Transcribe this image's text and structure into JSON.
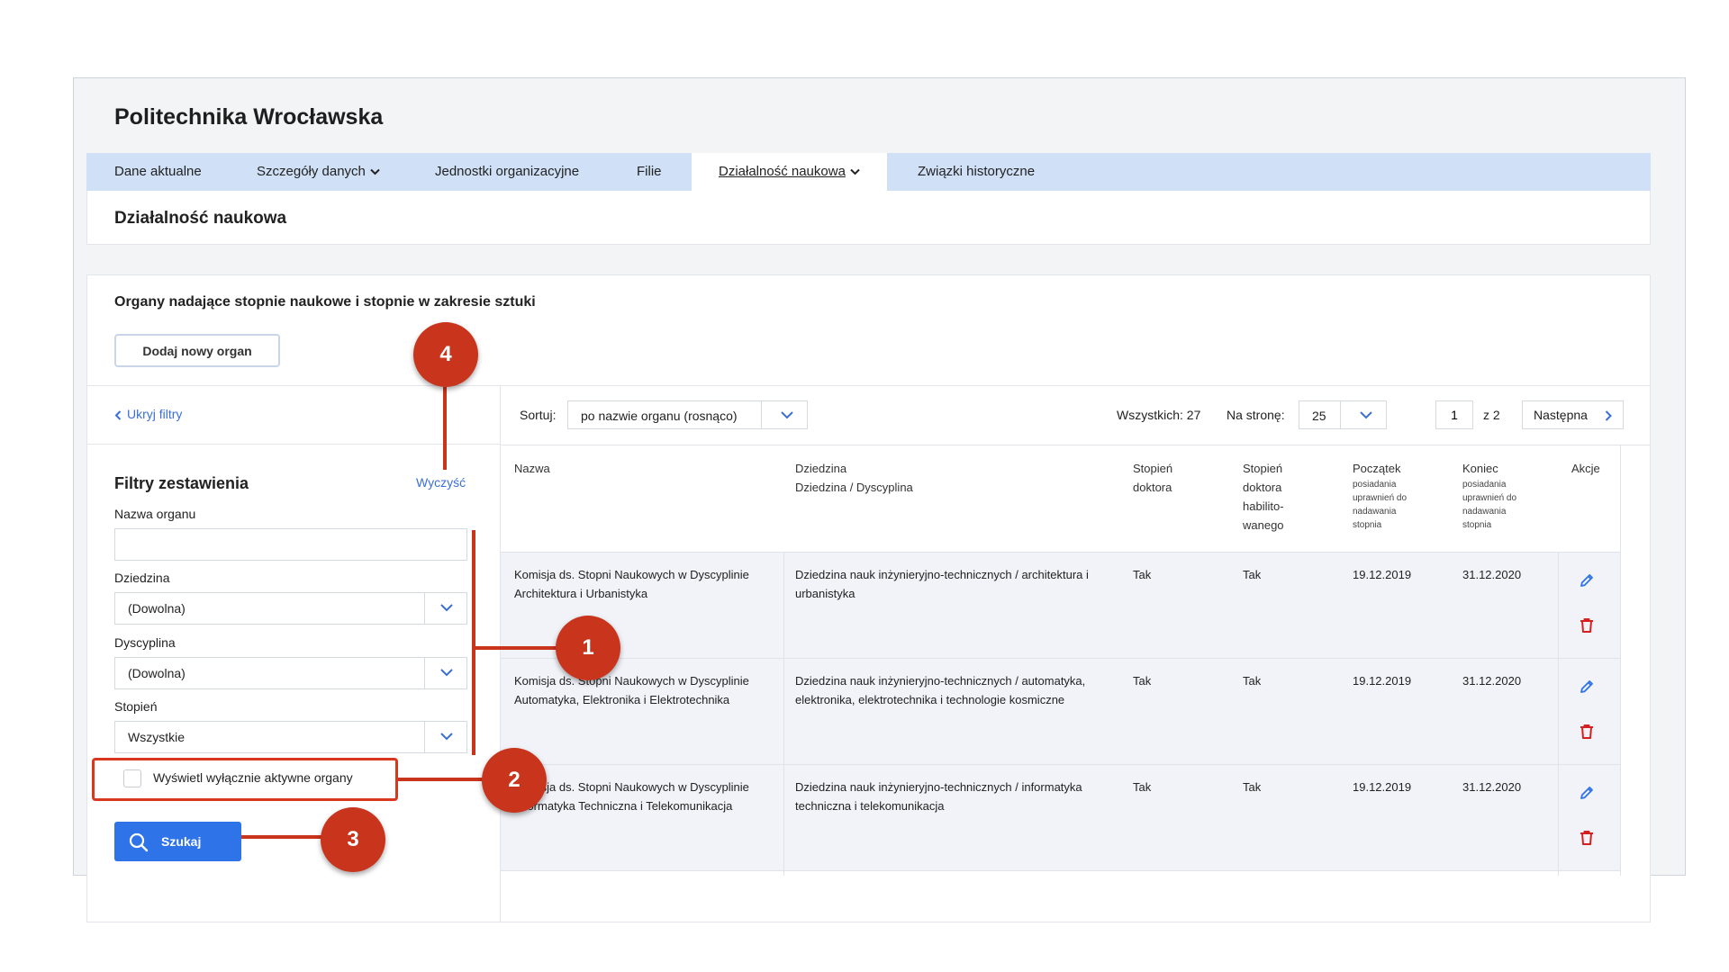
{
  "app": {
    "title": "Politechnika Wrocławska"
  },
  "nav": {
    "items": [
      {
        "label": "Dane aktualne"
      },
      {
        "label": "Szczegóły danych"
      },
      {
        "label": "Jednostki organizacyjne"
      },
      {
        "label": "Filie"
      },
      {
        "label": "Działalność naukowa"
      },
      {
        "label": "Związki historyczne"
      }
    ],
    "active": "Działalność naukowa"
  },
  "section": {
    "title": "Działalność naukowa"
  },
  "organs": {
    "heading": "Organy nadające stopnie naukowe i stopnie w zakresie sztuki",
    "add_button": "Dodaj nowy organ"
  },
  "filters": {
    "hide_link": "Ukryj filtry",
    "title": "Filtry zestawienia",
    "clear_link": "Wyczyść",
    "organ_name_label": "Nazwa organu",
    "organ_name_value": "",
    "domain_label": "Dziedzina",
    "domain_value": "(Dowolna)",
    "discipline_label": "Dyscyplina",
    "discipline_value": "(Dowolna)",
    "degree_label": "Stopień",
    "degree_value": "Wszystkie",
    "active_only_label": "Wyświetl wyłącznie aktywne organy",
    "active_only_checked": false,
    "search_button": "Szukaj"
  },
  "toolbar": {
    "sort_label": "Sortuj:",
    "sort_value": "po nazwie organu (rosnąco)",
    "total": "Wszystkich: 27",
    "per_page_label": "Na stronę:",
    "per_page_value": "25",
    "current_page": "1",
    "page_of": "z  2",
    "next_button": "Następna"
  },
  "table": {
    "headers": {
      "name": "Nazwa",
      "domain": "Dziedzina",
      "domain_sub": "Dziedzina / Dyscyplina",
      "doctor": "Stopień doktora",
      "habil": "Stopień doktora habilito-wanego",
      "start": "Początek",
      "start_sub": "posiadania uprawnień do nadawania stopnia",
      "end": "Koniec",
      "end_sub": "posiadania uprawnień do nadawania stopnia",
      "actions": "Akcje"
    },
    "rows": [
      {
        "name": "Komisja ds. Stopni Naukowych w Dyscyplinie Architektura i Urbanistyka",
        "domain": "Dziedzina nauk inżynieryjno-technicznych / architektura i urbanistyka",
        "doctor": "Tak",
        "habil": "Tak",
        "start": "19.12.2019",
        "end": "31.12.2020"
      },
      {
        "name": "Komisja ds. Stopni Naukowych w Dyscyplinie Automatyka, Elektronika i Elektrotechnika",
        "domain": "Dziedzina nauk inżynieryjno-technicznych / automatyka, elektronika, elektrotechnika i technologie kosmiczne",
        "doctor": "Tak",
        "habil": "Tak",
        "start": "19.12.2019",
        "end": "31.12.2020"
      },
      {
        "name": "Komisja ds. Stopni Naukowych w Dyscyplinie Informatyka Techniczna i Telekomunikacja",
        "domain": "Dziedzina nauk inżynieryjno-technicznych / informatyka techniczna i telekomunikacja",
        "doctor": "Tak",
        "habil": "Tak",
        "start": "19.12.2019",
        "end": "31.12.2020"
      }
    ]
  },
  "callouts": [
    "1",
    "2",
    "3",
    "4"
  ],
  "colors": {
    "accent": "#2e73e8",
    "nav_bg": "#cfe0f7",
    "callout": "#c9341c",
    "delete": "#d6201f",
    "edit": "#2e73e8",
    "row_alt": "#f1f3f9"
  }
}
